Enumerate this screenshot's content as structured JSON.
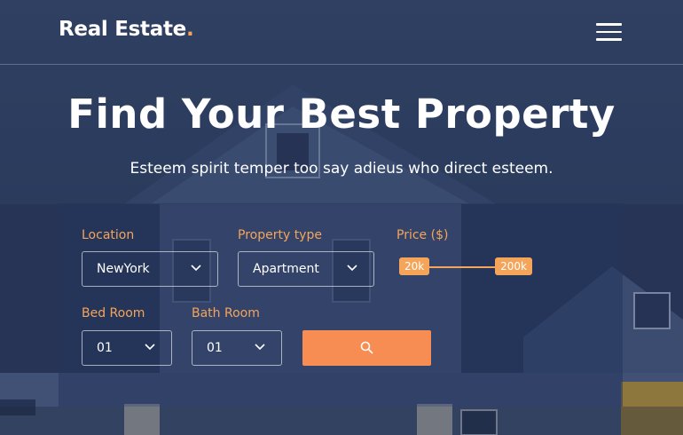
{
  "header": {
    "logo_text": "Real Estate",
    "logo_dot": ".",
    "menu_icon": "hamburger-menu-icon"
  },
  "hero": {
    "title": "Find Your Best Property",
    "subtitle": "Esteem spirit temper too say adieus who direct esteem."
  },
  "search": {
    "location": {
      "label": "Location",
      "value": "NewYork"
    },
    "property_type": {
      "label": "Property type",
      "value": "Apartment"
    },
    "price": {
      "label": "Price ($)",
      "min_label": "20k",
      "max_label": "200k"
    },
    "bed_room": {
      "label": "Bed Room",
      "value": "01"
    },
    "bath_room": {
      "label": "Bath Room",
      "value": "01"
    },
    "search_icon": "search-icon"
  },
  "colors": {
    "accent": "#f5a55a",
    "button": "#f78d52",
    "background": "#34476b"
  }
}
